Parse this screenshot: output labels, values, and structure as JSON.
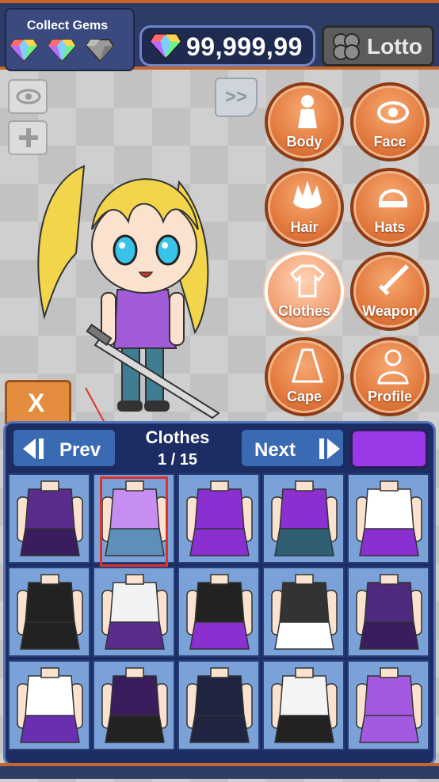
{
  "topbar": {
    "gems_title": "Collect Gems",
    "currency_amount": "99,999,99",
    "lotto_label": "Lotto"
  },
  "categories": [
    {
      "label": "Body",
      "icon": "body-icon"
    },
    {
      "label": "Face",
      "icon": "eye-icon"
    },
    {
      "label": "Hair",
      "icon": "hair-icon"
    },
    {
      "label": "Hats",
      "icon": "cap-icon"
    },
    {
      "label": "Clothes",
      "icon": "shirt-icon",
      "active": true
    },
    {
      "label": "Weapon",
      "icon": "sword-icon"
    },
    {
      "label": "Cape",
      "icon": "cape-icon"
    },
    {
      "label": "Profile",
      "icon": "person-icon"
    }
  ],
  "left_tools": {
    "forward_label": ">>",
    "close_label": "X"
  },
  "panel": {
    "prev_label": "Prev",
    "next_label": "Next",
    "title": "Clothes",
    "page": "1 / 15",
    "color_swatch": "#9a39e7"
  },
  "colors": {
    "accent_orange": "#e27a3e",
    "panel_blue": "#1b2d63",
    "cell_blue": "#7aa2d8",
    "selection_red": "#e0302a",
    "purple": "#8a2fd0"
  },
  "items": [
    {
      "name": "purple-armor-outfit"
    },
    {
      "name": "light-purple-tshirt",
      "selected": true
    },
    {
      "name": "purple-dress"
    },
    {
      "name": "purple-tank-top"
    },
    {
      "name": "purple-white-raglan"
    },
    {
      "name": "black-crop-top-skirt"
    },
    {
      "name": "white-sailor-uniform"
    },
    {
      "name": "black-school-uniform"
    },
    {
      "name": "dark-blazer-outfit"
    },
    {
      "name": "purple-track-jacket"
    },
    {
      "name": "white-sailor-top"
    },
    {
      "name": "purple-hoodie-shorts"
    },
    {
      "name": "navy-sailor-dress"
    },
    {
      "name": "white-labcoat"
    },
    {
      "name": "purple-bikini"
    }
  ]
}
